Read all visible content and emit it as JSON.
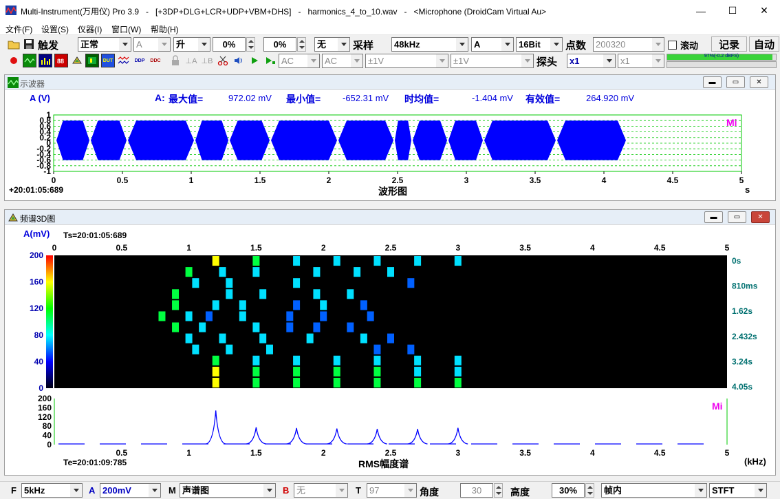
{
  "window": {
    "title": "Multi-Instrument(万用仪) Pro 3.9   -   [+3DP+DLG+LCR+UDP+VBM+DHS]   -   harmonics_4_to_10.wav   -   <Microphone (DroidCam Virtual Au>",
    "minimize": "—",
    "maximize": "☐",
    "close": "✕"
  },
  "menu": [
    "文件(F)",
    "设置(S)",
    "仪器(I)",
    "窗口(W)",
    "帮助(H)"
  ],
  "toolbar1": {
    "trigger_label": "触发",
    "trigger_mode": "正常",
    "trigger_channel": "A",
    "trigger_edge": "升",
    "trigger_level": "0%",
    "trigger_pretrigger": "0%",
    "trigger_source": "无",
    "sample_label": "采样",
    "sample_rate": "48kHz",
    "channel": "A",
    "bits": "16Bit",
    "points_label": "点数",
    "points": "200320",
    "scroll_label": "滚动",
    "record_label": "记录",
    "auto_label": "自动"
  },
  "toolbar2": {
    "coupling_a": "AC",
    "coupling_b": "AC",
    "range_a": "±1V",
    "range_b": "±1V",
    "probe_label": "探头",
    "probe_a": "x1",
    "probe_b": "x1",
    "level_meter": "97%(-0.2 dBFS)",
    "level_percent": 97
  },
  "oscilloscope": {
    "title": "示波器",
    "channel_label": "A (V)",
    "stats_channel": "A:",
    "max_label": "最大值=",
    "max_value": "972.02 mV",
    "min_label": "最小值=",
    "min_value": "-652.31 mV",
    "mean_label": "时均值=",
    "mean_value": "-1.404 mV",
    "rms_label": "有效值=",
    "rms_value": "264.920 mV",
    "time_stamp": "+20:01:05:689",
    "chart_label": "波形图",
    "x_unit": "s",
    "watermark": "Mi"
  },
  "spectrum3d": {
    "title": "频谱3D图",
    "channel_label": "A(mV)",
    "ts_label": "Ts=20:01:05:689",
    "te_label": "Te=20:01:09:785",
    "chart_label": "RMS幅度谱",
    "x_unit": "(kHz)",
    "watermark": "Mi",
    "time_labels": [
      "0s",
      "810ms",
      "1.62s",
      "2.432s",
      "3.24s",
      "4.05s"
    ]
  },
  "statusbar": {
    "f_label": "F",
    "f_value": "5kHz",
    "a_label": "A",
    "a_value": "200mV",
    "m_label": "M",
    "m_value": "声谱图",
    "b_label": "B",
    "b_value": "无",
    "t_label": "T",
    "t_value": "97",
    "angle_label": "角度",
    "angle_value": "30",
    "height_label": "高度",
    "height_value": "30%",
    "frame_mode": "帧内",
    "method": "STFT"
  },
  "colors": {
    "wave_blue": "#0000ff",
    "grid_green": "#00c800",
    "axis_teal": "#007070",
    "label_blue": "#0000dd",
    "watermark_magenta": "#ee00ee"
  },
  "chart_data": [
    {
      "type": "line",
      "xlabel": "波形图",
      "ylabel": "A (V)",
      "x_ticks": [
        "0",
        "0.5",
        "1",
        "1.5",
        "2",
        "2.5",
        "3",
        "3.5",
        "4",
        "4.5",
        "5"
      ],
      "y_ticks": [
        "1",
        "0.8",
        "0.6",
        "0.4",
        "0.2",
        "0",
        "-0.2",
        "-0.4",
        "-0.6",
        "-0.8",
        "-1"
      ],
      "xlim": [
        0,
        5
      ],
      "ylim": [
        -1,
        1
      ],
      "segments": [
        [
          0.02,
          0.26
        ],
        [
          0.27,
          0.53
        ],
        [
          0.54,
          1.02
        ],
        [
          1.03,
          1.27
        ],
        [
          1.28,
          1.57
        ],
        [
          1.58,
          2.06
        ],
        [
          2.07,
          2.47
        ],
        [
          2.48,
          2.6
        ],
        [
          2.61,
          2.86
        ],
        [
          2.87,
          3.12
        ],
        [
          3.13,
          3.65
        ],
        [
          3.66,
          4.16
        ]
      ],
      "envelope_max": 0.8,
      "envelope_min": -0.6
    },
    {
      "type": "heatmap",
      "xlabel": "",
      "ylabel": "A(mV)",
      "x_ticks": [
        "0",
        "0.5",
        "1",
        "1.5",
        "2",
        "2.5",
        "3",
        "3.5",
        "4",
        "4.5",
        "5"
      ],
      "y_ticks": [
        "200",
        "160",
        "120",
        "80",
        "40",
        "0"
      ],
      "xlim": [
        0,
        5
      ],
      "ylim": [
        0,
        200
      ],
      "cells": [
        [
          1.2,
          0,
          180
        ],
        [
          1.5,
          0,
          170
        ],
        [
          1.8,
          0,
          150
        ],
        [
          2.1,
          0,
          150
        ],
        [
          2.4,
          0,
          150
        ],
        [
          2.7,
          0,
          140
        ],
        [
          3.0,
          0,
          140
        ],
        [
          1.0,
          1,
          170
        ],
        [
          1.25,
          1,
          140
        ],
        [
          1.5,
          1,
          150
        ],
        [
          1.95,
          1,
          140
        ],
        [
          2.25,
          1,
          140
        ],
        [
          2.5,
          1,
          140
        ],
        [
          1.05,
          2,
          150
        ],
        [
          1.3,
          2,
          150
        ],
        [
          1.8,
          2,
          140
        ],
        [
          2.65,
          2,
          120
        ],
        [
          0.9,
          3,
          160
        ],
        [
          1.3,
          3,
          140
        ],
        [
          1.55,
          3,
          140
        ],
        [
          1.95,
          3,
          150
        ],
        [
          2.2,
          3,
          140
        ],
        [
          0.9,
          4,
          170
        ],
        [
          1.2,
          4,
          140
        ],
        [
          1.4,
          4,
          140
        ],
        [
          1.8,
          4,
          130
        ],
        [
          2.0,
          4,
          140
        ],
        [
          2.3,
          4,
          130
        ],
        [
          0.8,
          5,
          160
        ],
        [
          1.0,
          5,
          140
        ],
        [
          1.15,
          5,
          130
        ],
        [
          1.4,
          5,
          140
        ],
        [
          1.75,
          5,
          130
        ],
        [
          2.0,
          5,
          130
        ],
        [
          2.35,
          5,
          130
        ],
        [
          0.9,
          6,
          160
        ],
        [
          1.1,
          6,
          140
        ],
        [
          1.5,
          6,
          140
        ],
        [
          1.75,
          6,
          130
        ],
        [
          1.95,
          6,
          130
        ],
        [
          2.2,
          6,
          130
        ],
        [
          1.0,
          7,
          150
        ],
        [
          1.25,
          7,
          140
        ],
        [
          1.55,
          7,
          140
        ],
        [
          1.9,
          7,
          140
        ],
        [
          2.3,
          7,
          140
        ],
        [
          2.5,
          7,
          120
        ],
        [
          1.05,
          8,
          150
        ],
        [
          1.3,
          8,
          140
        ],
        [
          1.6,
          8,
          140
        ],
        [
          2.4,
          8,
          130
        ],
        [
          2.65,
          8,
          130
        ],
        [
          1.2,
          9,
          170
        ],
        [
          1.5,
          9,
          150
        ],
        [
          1.8,
          9,
          150
        ],
        [
          2.1,
          9,
          150
        ],
        [
          2.4,
          9,
          150
        ],
        [
          2.7,
          9,
          150
        ],
        [
          3.0,
          9,
          140
        ],
        [
          1.2,
          10,
          180
        ],
        [
          1.5,
          10,
          160
        ],
        [
          1.8,
          10,
          160
        ],
        [
          2.1,
          10,
          160
        ],
        [
          2.4,
          10,
          160
        ],
        [
          2.7,
          10,
          150
        ],
        [
          3.0,
          10,
          150
        ],
        [
          1.2,
          11,
          200
        ],
        [
          1.5,
          11,
          170
        ],
        [
          1.8,
          11,
          170
        ],
        [
          2.1,
          11,
          170
        ],
        [
          2.4,
          11,
          170
        ],
        [
          2.7,
          11,
          160
        ],
        [
          3.0,
          11,
          160
        ]
      ]
    },
    {
      "type": "line",
      "xlabel": "RMS幅度谱",
      "ylabel": "",
      "x_ticks": [
        "0.5",
        "1",
        "1.5",
        "2",
        "2.5",
        "3",
        "3.5",
        "4",
        "4.5",
        "5"
      ],
      "y_ticks": [
        "200",
        "160",
        "120",
        "80",
        "40",
        "0"
      ],
      "xlim": [
        0,
        5
      ],
      "ylim": [
        0,
        200
      ],
      "peaks": [
        [
          1.2,
          148
        ],
        [
          1.5,
          75
        ],
        [
          1.8,
          72
        ],
        [
          2.1,
          70
        ],
        [
          2.4,
          68
        ],
        [
          2.7,
          68
        ],
        [
          3.0,
          73
        ]
      ]
    }
  ]
}
